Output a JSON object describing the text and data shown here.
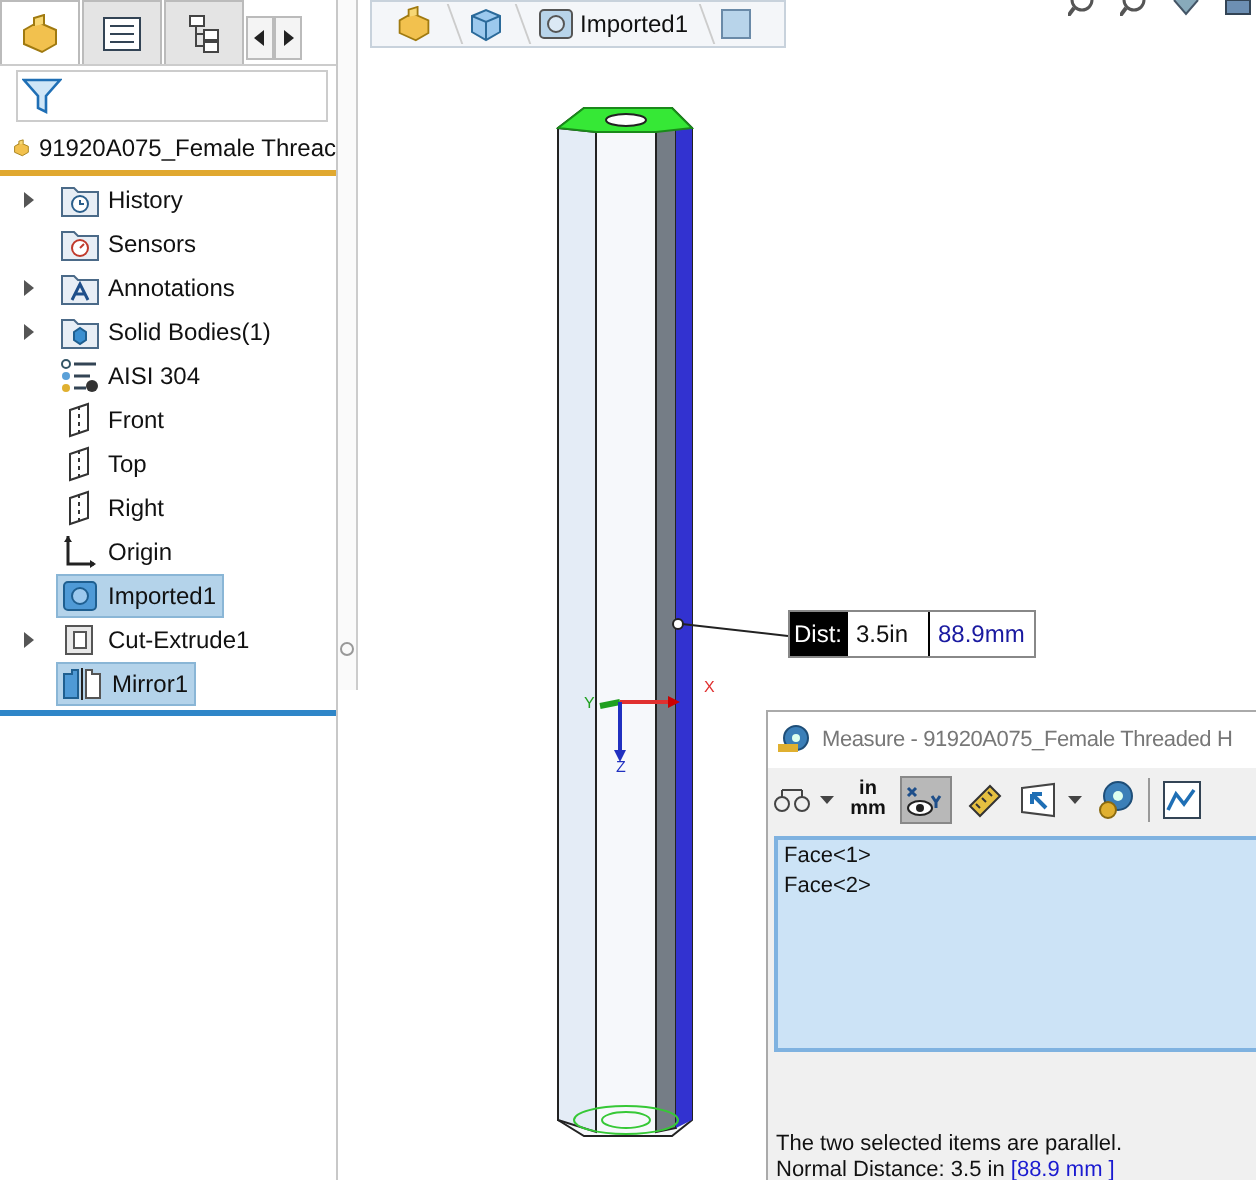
{
  "feature_tabs": [
    {
      "kind": "part",
      "selected": true
    },
    {
      "kind": "property",
      "selected": false
    },
    {
      "kind": "config",
      "selected": false
    }
  ],
  "tree": {
    "root": "91920A075_Female Threac",
    "items": [
      {
        "label": "History",
        "kind": "history",
        "expandable": true,
        "selected": false
      },
      {
        "label": "Sensors",
        "kind": "sensors",
        "expandable": false,
        "selected": false
      },
      {
        "label": "Annotations",
        "kind": "annotations",
        "expandable": true,
        "selected": false
      },
      {
        "label": "Solid Bodies(1)",
        "kind": "bodies",
        "expandable": true,
        "selected": false
      },
      {
        "label": "AISI 304",
        "kind": "material",
        "expandable": false,
        "selected": false
      },
      {
        "label": "Front",
        "kind": "plane",
        "expandable": false,
        "selected": false
      },
      {
        "label": "Top",
        "kind": "plane",
        "expandable": false,
        "selected": false
      },
      {
        "label": "Right",
        "kind": "plane",
        "expandable": false,
        "selected": false
      },
      {
        "label": "Origin",
        "kind": "origin",
        "expandable": false,
        "selected": false
      },
      {
        "label": "Imported1",
        "kind": "imported",
        "expandable": false,
        "selected": true
      },
      {
        "label": "Cut-Extrude1",
        "kind": "cut",
        "expandable": true,
        "selected": false
      },
      {
        "label": "Mirror1",
        "kind": "mirror",
        "expandable": false,
        "selected": true
      }
    ]
  },
  "breadcrumb": {
    "label": "Imported1"
  },
  "callout": {
    "label": "Dist:",
    "value_in": "3.5in",
    "value_mm": "88.9mm"
  },
  "triad": {
    "x": "X",
    "y": "Y",
    "z": "Z"
  },
  "measure": {
    "title": "Measure - 91920A075_Female Threaded H",
    "toolbar": [
      {
        "kind": "arc",
        "dropdown": true,
        "selected": false
      },
      {
        "kind": "units",
        "top": "in",
        "bottom": "mm",
        "dropdown": false,
        "selected": false
      },
      {
        "kind": "xyz",
        "dropdown": false,
        "selected": true
      },
      {
        "kind": "ruler",
        "dropdown": false,
        "selected": false
      },
      {
        "kind": "projection",
        "dropdown": true,
        "selected": false
      },
      {
        "kind": "history",
        "dropdown": false,
        "selected": false
      },
      {
        "kind": "sensor",
        "dropdown": false,
        "selected": false
      }
    ],
    "selections": [
      "Face<1>",
      "Face<2>"
    ],
    "message": "The two selected items are parallel.",
    "result": {
      "label": "Normal Distance: 3.5 in",
      "value": "[88.9 mm ]"
    }
  }
}
